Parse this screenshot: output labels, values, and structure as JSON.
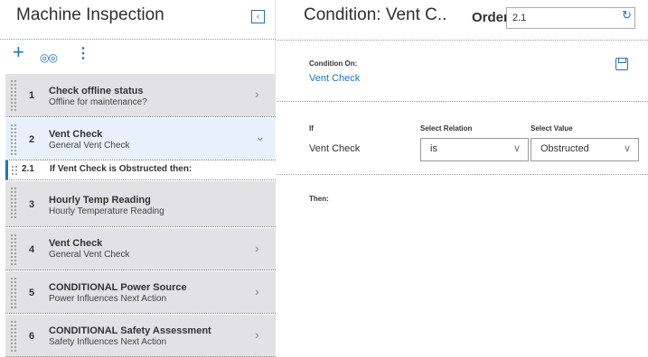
{
  "left_panel": {
    "title": "Machine Inspection",
    "collapse_glyph": "‹",
    "toolbar": {
      "add_icon": "+",
      "find_icon": "🔭",
      "more_icon": "⋮"
    },
    "steps": [
      {
        "num": "1",
        "title": "Check offline status",
        "subtitle": "Offline for maintenance?",
        "chevron": "›"
      },
      {
        "num": "2",
        "title": "Vent Check",
        "subtitle": "General Vent Check",
        "chevron": "⌄"
      },
      {
        "num": "3",
        "title": "Hourly Temp Reading",
        "subtitle": "Hourly Temperature Reading",
        "chevron": ""
      },
      {
        "num": "4",
        "title": "Vent Check",
        "subtitle": "General Vent Check",
        "chevron": "›"
      },
      {
        "num": "5",
        "title": "CONDITIONAL Power Source",
        "subtitle": "Power Influences Next Action",
        "chevron": "›"
      },
      {
        "num": "6",
        "title": "CONDITIONAL Safety Assessment",
        "subtitle": "Safety Influences Next Action",
        "chevron": "›"
      }
    ],
    "sub_step": {
      "num": "2.1",
      "text": "If Vent Check is Obstructed then:"
    }
  },
  "right_panel": {
    "title": "Condition: Vent C..",
    "order_label": "Order",
    "order_value": "2.1",
    "refresh_icon": "⟳",
    "condition_on_label": "Condition On:",
    "condition_on_value": "Vent Check",
    "if_label": "If",
    "select_relation_label": "Select Relation",
    "select_value_label": "Select Value",
    "if_value": "Vent Check",
    "relation_value": "is",
    "value_value": "Obstructed",
    "dropdown_arrow": "⌵",
    "then_label": "Then:"
  },
  "colors": {
    "accent": "#1a73c8",
    "step_bg": "#e2e2e4",
    "active_step_bg": "#e8f1fb"
  }
}
